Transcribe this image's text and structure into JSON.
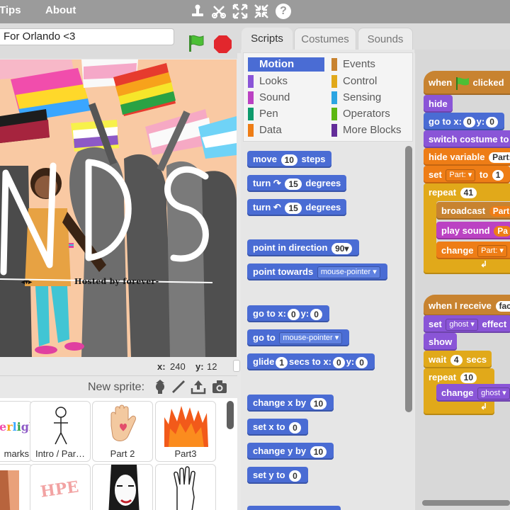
{
  "menu": {
    "tips": "Tips",
    "about": "About"
  },
  "toolbar": {
    "help": "?"
  },
  "project": {
    "title": "For Orlando <3"
  },
  "stage": {
    "title_text": "NDS",
    "hosted_text": "Hosted by forever-",
    "x_label": "x:",
    "x_value": "240",
    "y_label": "y:",
    "y_value": "12"
  },
  "sprites": {
    "new_sprite_label": "New sprite:",
    "tiles": [
      {
        "label": "marks",
        "image": "rainbow-text-thumbnail"
      },
      {
        "label": "Intro / Par…",
        "image": "stick-figure-thumbnail"
      },
      {
        "label": "Part 2",
        "image": "hand-heart-thumbnail"
      },
      {
        "label": "Part3",
        "image": "fire-thumbnail"
      },
      {
        "label": "",
        "image": "portrait-thumbnail"
      },
      {
        "label": "",
        "image": "hope-text-thumbnail"
      },
      {
        "label": "",
        "image": "face-thumbnail"
      },
      {
        "label": "",
        "image": "raised-hand-thumbnail"
      }
    ]
  },
  "tabs": {
    "scripts": "Scripts",
    "costumes": "Costumes",
    "sounds": "Sounds"
  },
  "categories": {
    "motion": "Motion",
    "looks": "Looks",
    "sound": "Sound",
    "pen": "Pen",
    "data": "Data",
    "events": "Events",
    "control": "Control",
    "sensing": "Sensing",
    "operators": "Operators",
    "more": "More Blocks"
  },
  "blocks": {
    "move": {
      "pre": "move",
      "val": "10",
      "post": "steps"
    },
    "turn_cw": {
      "pre": "turn",
      "val": "15",
      "post": "degrees"
    },
    "turn_ccw": {
      "pre": "turn",
      "val": "15",
      "post": "degrees"
    },
    "point_dir": {
      "pre": "point in direction",
      "val": "90▾"
    },
    "point_towards": {
      "pre": "point towards",
      "val": "mouse-pointer ▾"
    },
    "goto_xy": {
      "pre": "go to x:",
      "x": "0",
      "mid": "y:",
      "y": "0"
    },
    "goto": {
      "pre": "go to",
      "val": "mouse-pointer ▾"
    },
    "glide": {
      "pre": "glide",
      "secs": "1",
      "mid": "secs to x:",
      "x": "0",
      "y_label": "y:",
      "y": "0"
    },
    "change_x": {
      "pre": "change x by",
      "val": "10"
    },
    "set_x": {
      "pre": "set x to",
      "val": "0"
    },
    "change_y": {
      "pre": "change y by",
      "val": "10"
    },
    "set_y": {
      "pre": "set y to",
      "val": "0"
    }
  },
  "script1": {
    "when_flag": {
      "pre": "when",
      "post": "clicked"
    },
    "hide": "hide",
    "goto": {
      "pre": "go to x:",
      "x": "0",
      "mid": "y:",
      "y": "0"
    },
    "switch_costume": "switch costume to",
    "hide_var": {
      "pre": "hide variable",
      "val": "Part:"
    },
    "set_var": {
      "pre": "set",
      "var": "Part: ▾",
      "mid": "to",
      "val": "1"
    },
    "repeat": {
      "pre": "repeat",
      "val": "41"
    },
    "broadcast": {
      "pre": "broadcast",
      "val": "Part"
    },
    "play_sound": {
      "pre": "play sound",
      "val": "Pa"
    },
    "change": {
      "pre": "change",
      "val": "Part: ▾"
    }
  },
  "script2": {
    "when_receive": {
      "pre": "when I receive",
      "val": "fac"
    },
    "set_effect": {
      "pre": "set",
      "val": "ghost ▾",
      "post": "effect"
    },
    "show": "show",
    "wait": {
      "pre": "wait",
      "val": "4",
      "post": "secs"
    },
    "repeat": {
      "pre": "repeat",
      "val": "10"
    },
    "change": {
      "pre": "change",
      "val": "ghost ▾"
    }
  },
  "colors": {
    "motion": "#4a6cd4",
    "looks": "#8a55d7",
    "sound": "#bb42c3",
    "pen": "#0e9a6c",
    "data": "#ee7d16",
    "events": "#c88330",
    "control": "#e1a91a",
    "sensing": "#2ca5e2",
    "operators": "#5cb712",
    "more": "#632d99"
  }
}
